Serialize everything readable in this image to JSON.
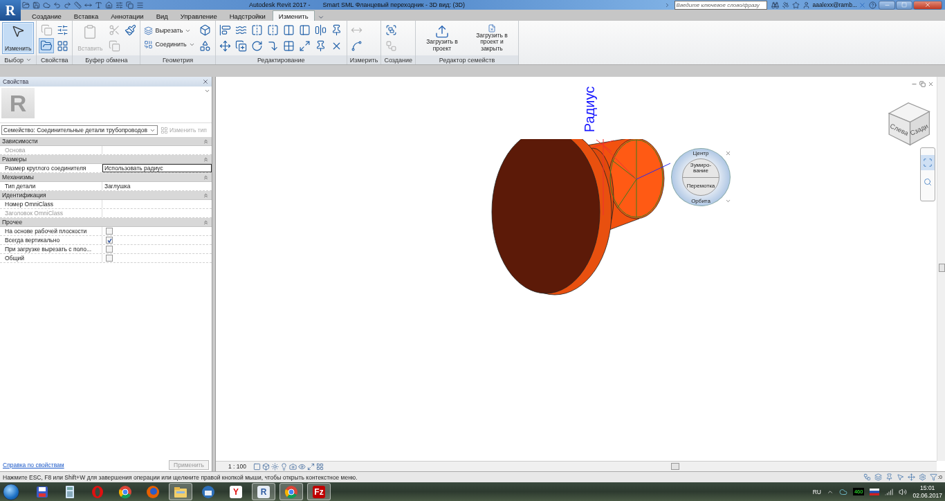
{
  "app_button": {
    "letter": "R"
  },
  "title_bar": {
    "app_title": "Autodesk Revit 2017 -",
    "document_title": "Smart SML Фланцевый переходник - 3D вид: (3D)",
    "search_placeholder": "Введите ключевое слово/фразу",
    "user": "aaalexx@ramb..."
  },
  "tabs": [
    {
      "label": "Создание",
      "selected": false
    },
    {
      "label": "Вставка",
      "selected": false
    },
    {
      "label": "Аннотации",
      "selected": false
    },
    {
      "label": "Вид",
      "selected": false
    },
    {
      "label": "Управление",
      "selected": false
    },
    {
      "label": "Надстройки",
      "selected": false
    },
    {
      "label": "Изменить",
      "selected": true
    }
  ],
  "ribbon": {
    "panels": [
      {
        "label": "Выбор",
        "has_menu": true,
        "tools": [
          {
            "kind": "large",
            "label": "Изменить",
            "selected": true,
            "disabled": false
          }
        ]
      },
      {
        "label": "Свойства",
        "tools": [
          {
            "kind": "icon",
            "selected": false,
            "disabled": true
          },
          {
            "kind": "icon",
            "selected": true,
            "disabled": false
          },
          {
            "kind": "icon",
            "selected": false,
            "disabled": false
          },
          {
            "kind": "icon",
            "selected": false,
            "disabled": false
          }
        ]
      },
      {
        "label": "Буфер обмена",
        "tools": [
          {
            "kind": "large",
            "label": "Вставить",
            "selected": false,
            "disabled": true
          },
          {
            "kind": "icon",
            "selected": false,
            "disabled": true
          },
          {
            "kind": "icon",
            "selected": false,
            "disabled": true
          },
          {
            "kind": "icon",
            "selected": false,
            "disabled": false
          }
        ]
      },
      {
        "label": "Геометрия",
        "tools": [
          {
            "kind": "small",
            "label": "Вырезать",
            "disabled": false
          },
          {
            "kind": "small",
            "label": "Соединить",
            "disabled": false
          },
          {
            "kind": "icon",
            "selected": false,
            "disabled": false
          },
          {
            "kind": "icon",
            "selected": false,
            "disabled": false
          }
        ]
      },
      {
        "label": "Редактирование",
        "tools": [
          {
            "kind": "icon",
            "selected": false,
            "disabled": false
          },
          {
            "kind": "icon",
            "selected": false,
            "disabled": false
          },
          {
            "kind": "icon",
            "selected": false,
            "disabled": false
          },
          {
            "kind": "icon",
            "selected": false,
            "disabled": false
          },
          {
            "kind": "icon",
            "selected": false,
            "disabled": false
          },
          {
            "kind": "icon",
            "selected": false,
            "disabled": false
          },
          {
            "kind": "icon",
            "selected": false,
            "disabled": false
          },
          {
            "kind": "icon",
            "selected": false,
            "disabled": false
          },
          {
            "kind": "icon",
            "selected": false,
            "disabled": false
          },
          {
            "kind": "icon",
            "selected": false,
            "disabled": false
          },
          {
            "kind": "icon",
            "selected": false,
            "disabled": false
          },
          {
            "kind": "icon",
            "selected": false,
            "disabled": false
          },
          {
            "kind": "icon",
            "selected": false,
            "disabled": false
          },
          {
            "kind": "icon",
            "selected": false,
            "disabled": false
          },
          {
            "kind": "icon",
            "selected": false,
            "disabled": false
          },
          {
            "kind": "icon",
            "selected": false,
            "disabled": false
          }
        ]
      },
      {
        "label": "Измерить",
        "tools": [
          {
            "kind": "icon",
            "selected": false,
            "disabled": true
          },
          {
            "kind": "icon",
            "selected": false,
            "disabled": false
          }
        ]
      },
      {
        "label": "Создание",
        "tools": [
          {
            "kind": "icon",
            "selected": false,
            "disabled": false
          },
          {
            "kind": "icon",
            "selected": false,
            "disabled": true
          }
        ]
      },
      {
        "label": "Редактор семейств",
        "tools": [
          {
            "kind": "large",
            "label": "Загрузить в проект",
            "selected": false,
            "disabled": false
          },
          {
            "kind": "large",
            "label": "Загрузить в проект и закрыть",
            "selected": false,
            "disabled": false
          }
        ]
      }
    ]
  },
  "properties": {
    "title": "Свойства",
    "type_image_letter": "R",
    "type_selector": "Семейство: Соединительные детали трубопроводов",
    "edit_type": {
      "label": "Изменить тип",
      "disabled": true
    },
    "groups": [
      {
        "name": "Зависимости",
        "expanded": true,
        "rows": [
          {
            "kind": "text",
            "name": "Основа",
            "value": "",
            "disabled": true,
            "focused": false
          }
        ]
      },
      {
        "name": "Размеры",
        "expanded": true,
        "rows": [
          {
            "kind": "text",
            "name": "Размер круглого соединителя",
            "value": "Использовать радиус",
            "disabled": false,
            "focused": true
          }
        ]
      },
      {
        "name": "Механизмы",
        "expanded": true,
        "rows": [
          {
            "kind": "text",
            "name": "Тип детали",
            "value": "Заглушка",
            "disabled": false,
            "focused": false
          }
        ]
      },
      {
        "name": "Идентификация",
        "expanded": true,
        "rows": [
          {
            "kind": "text",
            "name": "Номер OmniClass",
            "value": "",
            "disabled": false,
            "focused": false
          },
          {
            "kind": "text",
            "name": "Заголовок OmniClass",
            "value": "",
            "disabled": true,
            "focused": false
          }
        ]
      },
      {
        "name": "Прочее",
        "expanded": true,
        "rows": [
          {
            "kind": "checkbox",
            "name": "На основе рабочей плоскости",
            "checked": false,
            "disabled": false,
            "focused": false
          },
          {
            "kind": "checkbox",
            "name": "Всегда вертикально",
            "checked": true,
            "disabled": false,
            "focused": false
          },
          {
            "kind": "checkbox",
            "name": "При загрузке вырезать с поло...",
            "checked": false,
            "disabled": false,
            "focused": false
          },
          {
            "kind": "checkbox",
            "name": "Общий",
            "checked": false,
            "disabled": false,
            "focused": false
          }
        ]
      }
    ],
    "help_link": "Справка по свойствам",
    "apply": {
      "label": "Применить",
      "disabled": true
    }
  },
  "viewport": {
    "dimension_label": "Радиус",
    "view_cube_faces": [
      "Слева",
      "Сзади"
    ],
    "steering_wheel": {
      "top": "Центр",
      "zoom": "Зумиро-вание",
      "rewind": "Перемотка",
      "bottom": "Орбита"
    },
    "scale": "1 : 100"
  },
  "status_bar": {
    "message": "Нажмите ESC, F8 или Shift+W для завершения операции или щелкните правой кнопкой мыши, чтобы открыть контекстное меню.",
    "filter_count": ":0"
  },
  "taskbar": {
    "items": [
      {
        "kind": "floppy",
        "running": false
      },
      {
        "kind": "calculator",
        "running": false
      },
      {
        "kind": "opera",
        "running": false
      },
      {
        "kind": "chrome",
        "running": false
      },
      {
        "kind": "firefox",
        "running": false
      },
      {
        "kind": "explorer",
        "running": true
      },
      {
        "kind": "mail",
        "running": false
      },
      {
        "kind": "yandex",
        "running": false,
        "glyph": "Y"
      },
      {
        "kind": "revit",
        "running": true,
        "glyph": "R"
      },
      {
        "kind": "chrome",
        "running": true
      },
      {
        "kind": "filezilla",
        "running": true,
        "glyph": "Fz"
      }
    ],
    "language": "RU",
    "gpu_temp": "460",
    "time": "15:01",
    "date": "02.06.2017"
  }
}
